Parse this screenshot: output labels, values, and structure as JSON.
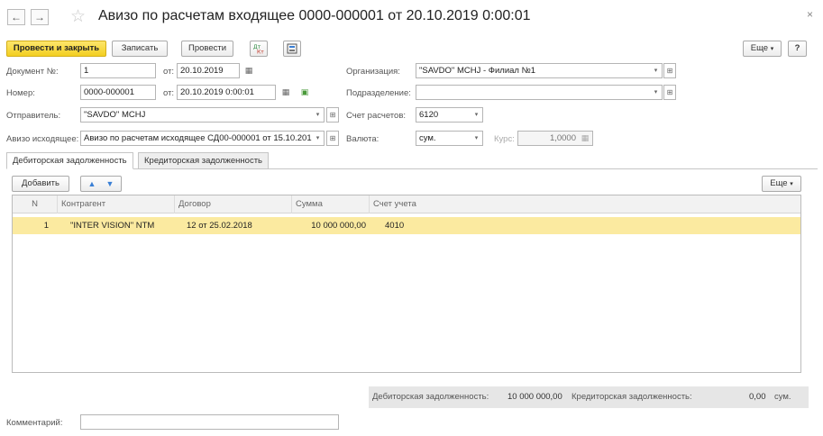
{
  "window": {
    "back_icon": "arrow-left-icon",
    "forward_icon": "arrow-right-icon",
    "favorite_icon": "star-icon",
    "title": "Авизо по расчетам входящее 0000-000001 от 20.10.2019 0:00:01",
    "close_glyph": "×"
  },
  "toolbar": {
    "post_close_label": "Провести и закрыть",
    "save_label": "Записать",
    "post_label": "Провести",
    "more_label": "Еще",
    "help_label": "?"
  },
  "form": {
    "doc_no_label": "Документ №:",
    "doc_no_value": "1",
    "from_label": "от:",
    "doc_date_value": "20.10.2019",
    "number_label": "Номер:",
    "number_value": "0000-000001",
    "from2_label": "от:",
    "number_date_value": "20.10.2019  0:00:01",
    "sender_label": "Отправитель:",
    "sender_value": "\"SAVDO\" MCHJ",
    "outgoing_label": "Авизо исходящее:",
    "outgoing_value": "Авизо по расчетам исходящее СД00-000001 от 15.10.201",
    "org_label": "Организация:",
    "org_value": "\"SAVDO\" MCHJ - Филиал №1",
    "division_label": "Подразделение:",
    "division_value": "",
    "account_label": "Счет расчетов:",
    "account_value": "6120",
    "currency_label": "Валюта:",
    "currency_value": "сум.",
    "rate_label": "Курс:",
    "rate_value": "1,0000"
  },
  "tabs": [
    {
      "label": "Дебиторская задолженность",
      "active": true
    },
    {
      "label": "Кредиторская задолженность",
      "active": false
    }
  ],
  "table_toolbar": {
    "add_label": "Добавить",
    "more_label": "Еще"
  },
  "table": {
    "headers": [
      "N",
      "Контрагент",
      "Договор",
      "Сумма",
      "Счет учета"
    ],
    "rows": [
      [
        "1",
        "\"INTER VISION\" NTM",
        "12 от 25.02.2018",
        "10 000 000,00",
        "4010"
      ]
    ]
  },
  "totals": {
    "debt_label": "Дебиторская задолженность:",
    "debt_value": "10 000 000,00",
    "credit_label": "Кредиторская задолженность:",
    "credit_value": "0,00",
    "currency": "сум."
  },
  "comment": {
    "label": "Комментарий:",
    "value": ""
  },
  "colors": {
    "primary_button": "#f3cf21",
    "selected_row": "#fbeaa0",
    "arrow_button": "#3a7fd5"
  }
}
